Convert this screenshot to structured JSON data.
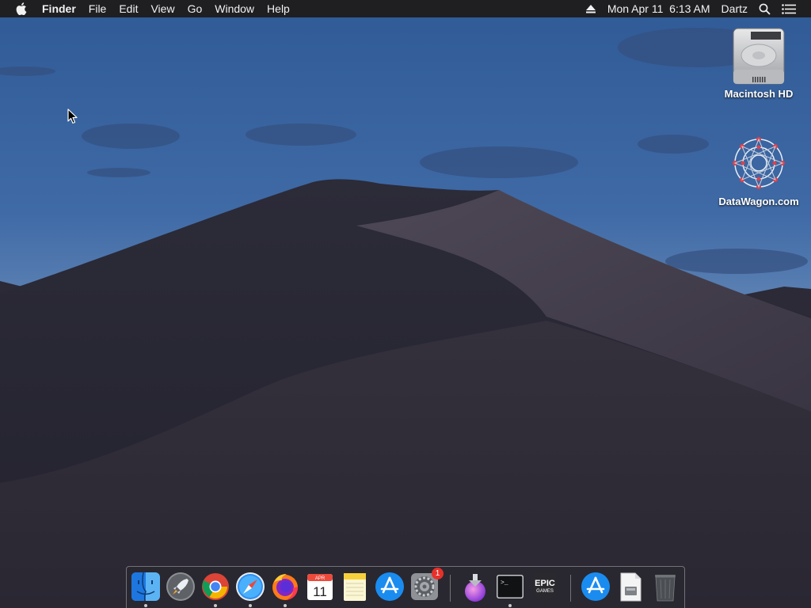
{
  "menubar": {
    "app_name": "Finder",
    "menus": [
      "File",
      "Edit",
      "View",
      "Go",
      "Window",
      "Help"
    ],
    "clock": "Mon Apr 11  6:13 AM",
    "user": "Dartz"
  },
  "desktop": {
    "icons": [
      {
        "label": "Macintosh HD",
        "icon": "hard-drive-icon"
      },
      {
        "label": "DataWagon.com",
        "icon": "datawagon-icon"
      }
    ]
  },
  "dock": {
    "items": [
      {
        "name": "finder",
        "running": true
      },
      {
        "name": "launchpad",
        "running": false
      },
      {
        "name": "chrome",
        "running": true
      },
      {
        "name": "safari",
        "running": true
      },
      {
        "name": "firefox",
        "running": true
      },
      {
        "name": "calendar",
        "running": false,
        "month": "APR",
        "day": "11"
      },
      {
        "name": "notes",
        "running": false
      },
      {
        "name": "app-store",
        "running": false
      },
      {
        "name": "system-preferences",
        "running": false,
        "badge": "1"
      },
      {
        "name": "installer",
        "running": false
      },
      {
        "name": "terminal",
        "running": true,
        "prompt": ">_"
      },
      {
        "name": "epic-games",
        "running": false,
        "text1": "EPIC",
        "text2": "GAMES"
      },
      {
        "name": "app-store-downloads",
        "running": false
      },
      {
        "name": "disk-image",
        "running": false
      },
      {
        "name": "trash",
        "running": false
      }
    ]
  }
}
